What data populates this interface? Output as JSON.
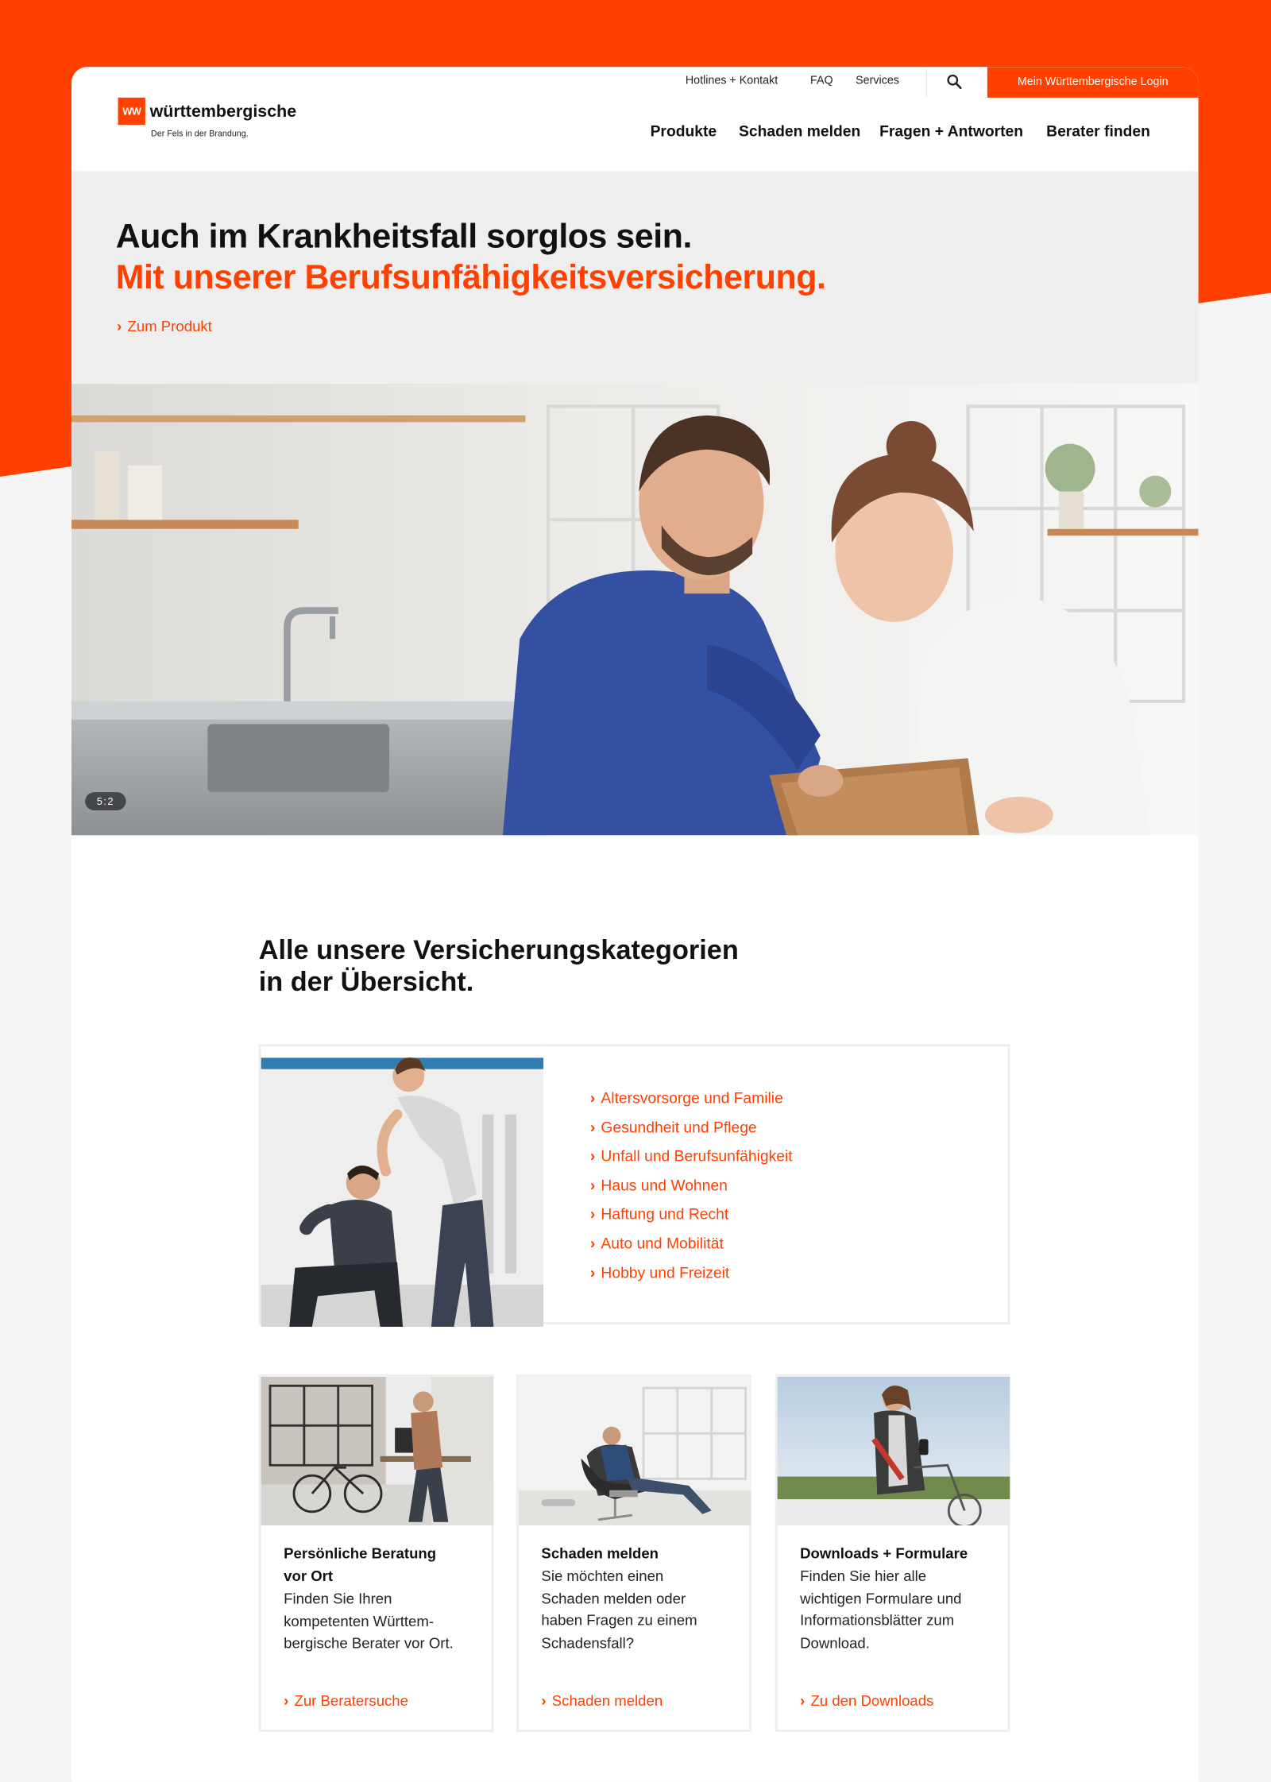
{
  "brand": {
    "logo_mark": "WW",
    "name": "württembergische",
    "claim": "Der Fels in der Brandung.",
    "accent_color": "#ff4000"
  },
  "header": {
    "meta_links": [
      "Hotlines + Kontakt",
      "FAQ",
      "Services"
    ],
    "search_icon": "search-icon",
    "login_label": "Mein Württembergische Login",
    "nav": [
      "Produkte",
      "Schaden melden",
      "Fragen + Antworten",
      "Berater finden"
    ]
  },
  "hero": {
    "headline": "Auch im Krankheitsfall sorglos sein.",
    "headline_accent": "Mit unserer Berufsunfähigkeitsversicherung.",
    "link": "Zum Produkt",
    "image_ratio_badge": "5:2"
  },
  "categories": {
    "title_line1": "Alle unsere Versicherungskategorien",
    "title_line2": "in der Übersicht.",
    "items": [
      "Altersvorsorge und Familie",
      "Gesundheit und Pflege",
      "Unfall und Berufsunfähigkeit",
      "Haus und Wohnen",
      "Haftung und Recht",
      "Auto und Mobilität",
      "Hobby und Freizeit"
    ]
  },
  "tiles": [
    {
      "title_line1": "Persönliche Beratung",
      "title_line2": "vor Ort",
      "text": [
        "Finden Sie Ihren",
        "kompetenten Württem-",
        "bergische Berater vor Ort."
      ],
      "link": "Zur Beratersuche"
    },
    {
      "title_line1": "Schaden melden",
      "title_line2": "",
      "text": [
        "Sie möchten einen",
        "Schaden melden oder",
        "haben Fragen zu einem",
        "Schadensfall?"
      ],
      "link": "Schaden melden"
    },
    {
      "title_line1": "Downloads + Formulare",
      "title_line2": "",
      "text": [
        "Finden Sie hier alle",
        "wichtigen Formulare und",
        "Informationsblätter zum",
        "Download."
      ],
      "link": "Zu den Downloads"
    }
  ]
}
